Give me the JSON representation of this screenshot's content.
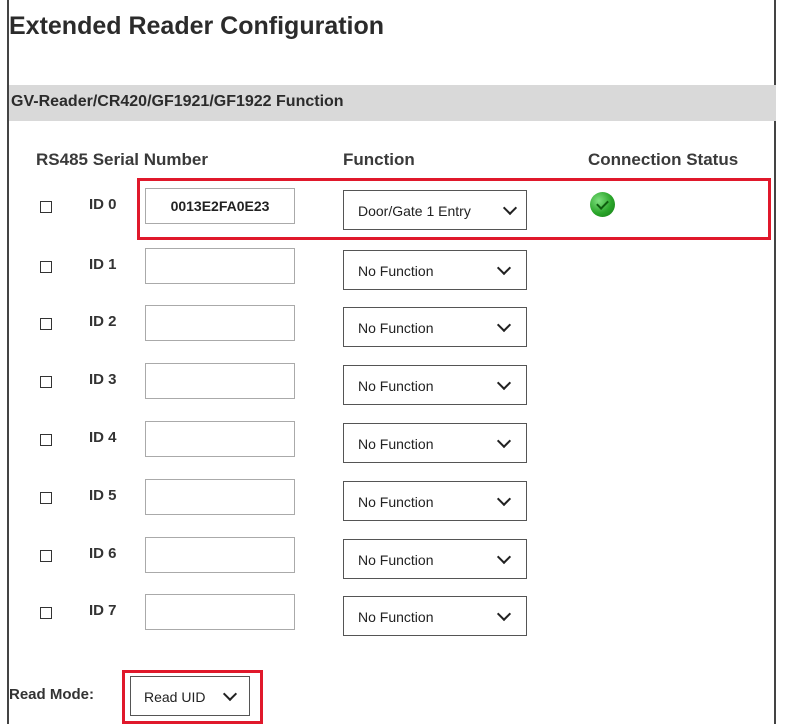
{
  "page": {
    "title": "Extended Reader Configuration"
  },
  "section": {
    "title": "GV-Reader/CR420/GF1921/GF1922 Function"
  },
  "columns": {
    "serial": "RS485 Serial Number",
    "function": "Function",
    "status": "Connection Status"
  },
  "readers": [
    {
      "id_label": "ID 0",
      "serial": "0013E2FA0E23",
      "function": "Door/Gate 1 Entry",
      "checked": false,
      "status": "connected",
      "status_icon": "green-check-circle-icon",
      "status_color": "#2aa52a"
    },
    {
      "id_label": "ID 1",
      "serial": "",
      "function": "No Function",
      "checked": false
    },
    {
      "id_label": "ID 2",
      "serial": "",
      "function": "No Function",
      "checked": false
    },
    {
      "id_label": "ID 3",
      "serial": "",
      "function": "No Function",
      "checked": false
    },
    {
      "id_label": "ID 4",
      "serial": "",
      "function": "No Function",
      "checked": false
    },
    {
      "id_label": "ID 5",
      "serial": "",
      "function": "No Function",
      "checked": false
    },
    {
      "id_label": "ID 6",
      "serial": "",
      "function": "No Function",
      "checked": false
    },
    {
      "id_label": "ID 7",
      "serial": "",
      "function": "No Function",
      "checked": false
    }
  ],
  "read_mode": {
    "label": "Read Mode:",
    "value": "Read UID"
  },
  "colors": {
    "highlight": "#e0182b",
    "section_bar": "#d9d9d9"
  }
}
